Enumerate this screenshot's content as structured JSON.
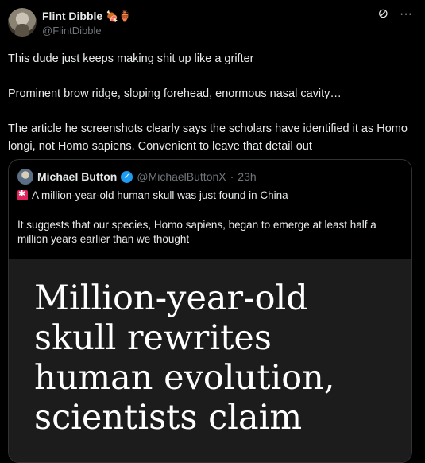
{
  "post": {
    "author_name": "Flint Dibble",
    "author_emojis": "🍖🏺",
    "author_handle": "@FlintDibble",
    "icons": {
      "grok": "grok-icon",
      "more": "more-icon"
    },
    "text": [
      "This dude just keeps making shit up like a grifter",
      "Prominent brow ridge, sloping forehead, enormous nasal cavity…",
      "The article he screenshots clearly says the scholars have identified it as Homo longi, not Homo sapiens. Convenient to leave that detail out"
    ]
  },
  "quote": {
    "author_name": "Michael Button",
    "author_handle": "@MichaelButtonX",
    "separator": "·",
    "time": "23h",
    "line1": "A million-year-old human skull was just found in China",
    "body": "It suggests that our species, Homo sapiens, began to emerge at least half a million years earlier than we thought",
    "image_headline": "Million-year-old skull rewrites human evolution, scientists claim"
  },
  "colors": {
    "background": "#000000",
    "text": "#e7e9ea",
    "muted": "#71767b",
    "verified": "#1d9bf0",
    "border": "#2f3336"
  }
}
